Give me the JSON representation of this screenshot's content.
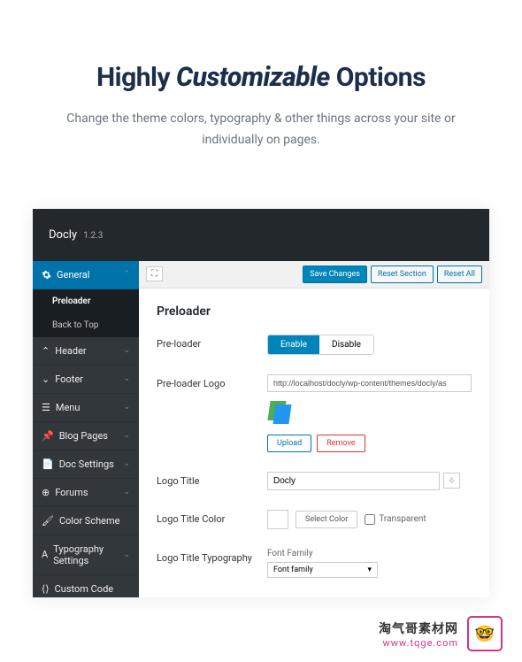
{
  "hero": {
    "title_pre": "Highly ",
    "title_em": "Customizable",
    "title_post": " Options",
    "subtitle": "Change the theme colors, typography & other things across your site or individually on pages."
  },
  "titlebar": {
    "name": "Docly",
    "version": "1.2.3"
  },
  "sidebar": {
    "general": "General",
    "preloader": "Preloader",
    "back_to_top": "Back to Top",
    "header": "Header",
    "footer": "Footer",
    "menu": "Menu",
    "blog": "Blog Pages",
    "doc": "Doc Settings",
    "forums": "Forums",
    "color": "Color Scheme",
    "typo": "Typography Settings",
    "custom": "Custom Code"
  },
  "toolbar": {
    "save": "Save Changes",
    "reset_section": "Reset Section",
    "reset_all": "Reset All"
  },
  "content": {
    "heading": "Preloader",
    "preloader_label": "Pre-loader",
    "enable": "Enable",
    "disable": "Disable",
    "logo_label": "Pre-loader Logo",
    "logo_url": "http://localhost/docly/wp-content/themes/docly/as",
    "upload": "Upload",
    "remove": "Remove",
    "title_label": "Logo Title",
    "title_value": "Docly",
    "color_label": "Logo Title Color",
    "select_color": "Select Color",
    "transparent": "Transparent",
    "typo_label": "Logo Title Typography",
    "font_family_label": "Font Family",
    "font_family_value": "Font family"
  },
  "footer": {
    "cn": "淘气哥素材网",
    "url": "www.tqge.com",
    "emoji": "🤓"
  }
}
